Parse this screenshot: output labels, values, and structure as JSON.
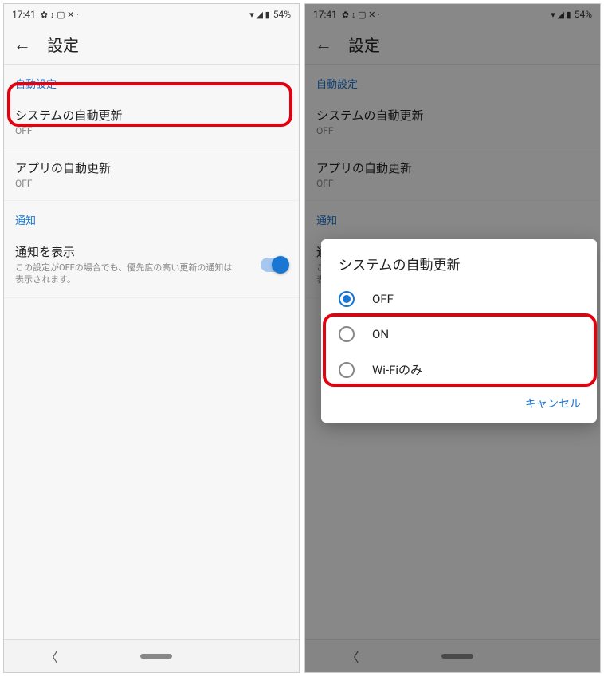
{
  "statusbar": {
    "time": "17:41",
    "icons_left": "✿ ↕ ▢ ✕ ·",
    "icons_right": "▾ ◢ ▮",
    "battery": "54%"
  },
  "header": {
    "title": "設定"
  },
  "sections": {
    "auto": {
      "header": "自動設定",
      "system_update": {
        "title": "システムの自動更新",
        "value": "OFF"
      },
      "app_update": {
        "title": "アプリの自動更新",
        "value": "OFF"
      }
    },
    "notify": {
      "header": "通知",
      "show": {
        "title": "通知を表示",
        "desc": "この設定がOFFの場合でも、優先度の高い更新の通知は表示されます。"
      }
    }
  },
  "dialog": {
    "title": "システムの自動更新",
    "options": [
      {
        "label": "OFF",
        "checked": true
      },
      {
        "label": "ON",
        "checked": false
      },
      {
        "label": "Wi-Fiのみ",
        "checked": false
      }
    ],
    "cancel": "キャンセル"
  }
}
